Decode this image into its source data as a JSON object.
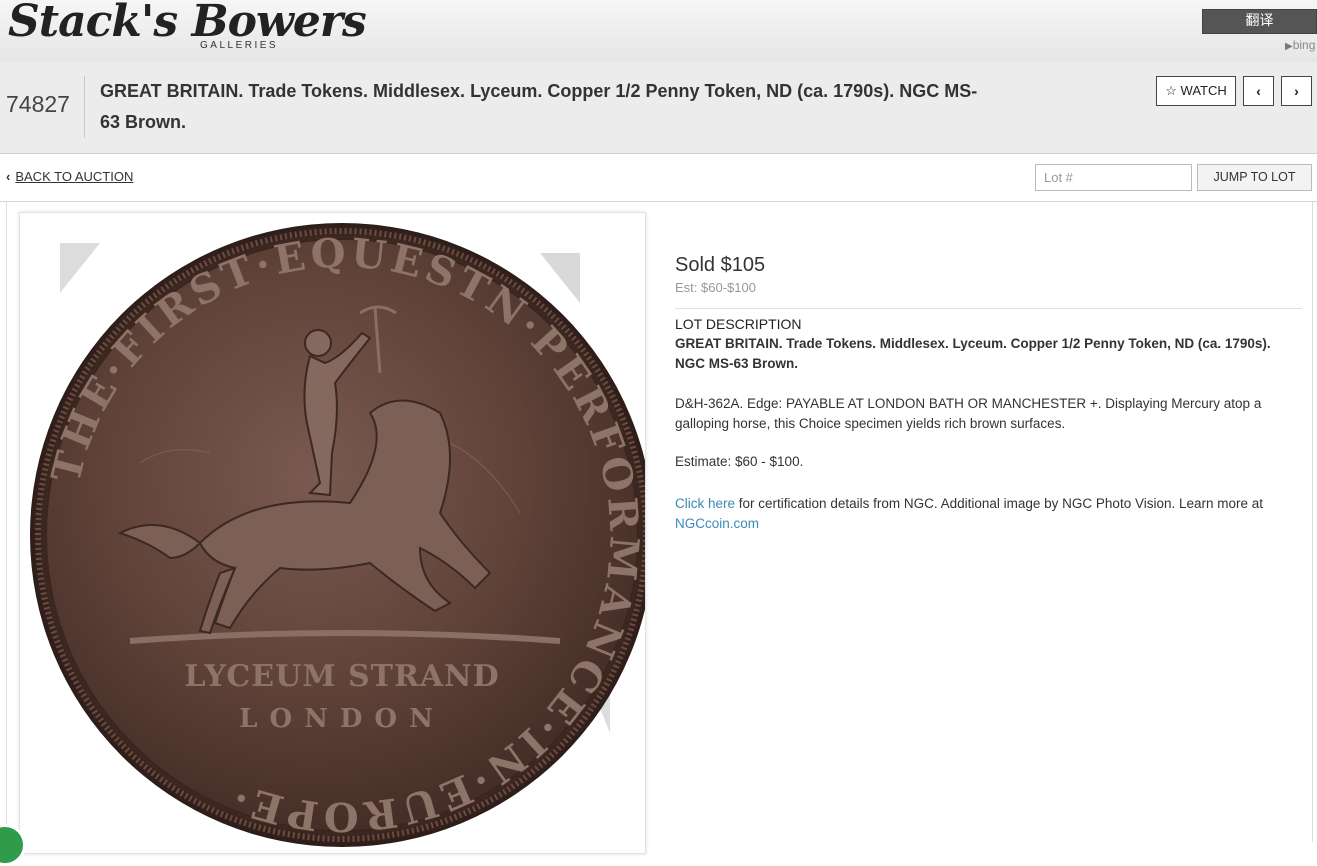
{
  "header": {
    "logo_text": "Stack's Bowers",
    "logo_sub": "GALLERIES",
    "translate_label": "翻译",
    "bing_label": "bing"
  },
  "lot": {
    "number": "74827",
    "title": "GREAT BRITAIN. Trade Tokens. Middlesex. Lyceum. Copper 1/2 Penny Token, ND (ca. 1790s). NGC MS-63 Brown.",
    "watch_label": "WATCH",
    "prev_icon": "chevron-left-icon",
    "next_icon": "chevron-right-icon"
  },
  "toolbar": {
    "back_label": "BACK TO AUCTION",
    "lot_input_placeholder": "Lot #",
    "lot_input_value": "",
    "jump_label": "JUMP TO LOT"
  },
  "coin": {
    "legend_top": "THE·FIRST·EQUESTN·PERFORMANCE·IN·EUROPE·",
    "line1": "LYCEUM STRAND",
    "line2": "LONDON"
  },
  "details": {
    "sold": "Sold $105",
    "estimate_small": "Est: $60-$100",
    "description_heading": "LOT DESCRIPTION",
    "description_title": "GREAT BRITAIN. Trade Tokens. Middlesex. Lyceum. Copper 1/2 Penny Token, ND (ca. 1790s). NGC MS-63 Brown.",
    "description_body": "D&H-362A. Edge: PAYABLE AT LONDON BATH OR MANCHESTER +. Displaying Mercury atop a galloping horse, this Choice specimen yields rich brown surfaces.",
    "estimate_line": "Estimate: $60 - $100.",
    "cert_link": "Click here",
    "cert_text": " for certification details from NGC. Additional image by NGC Photo Vision. Learn more at ",
    "ngc_link": "NGCcoin.com"
  },
  "colors": {
    "coin_brown": "#5a3e35",
    "link_blue": "#3a8ab8",
    "header_bg": "#ececec"
  }
}
